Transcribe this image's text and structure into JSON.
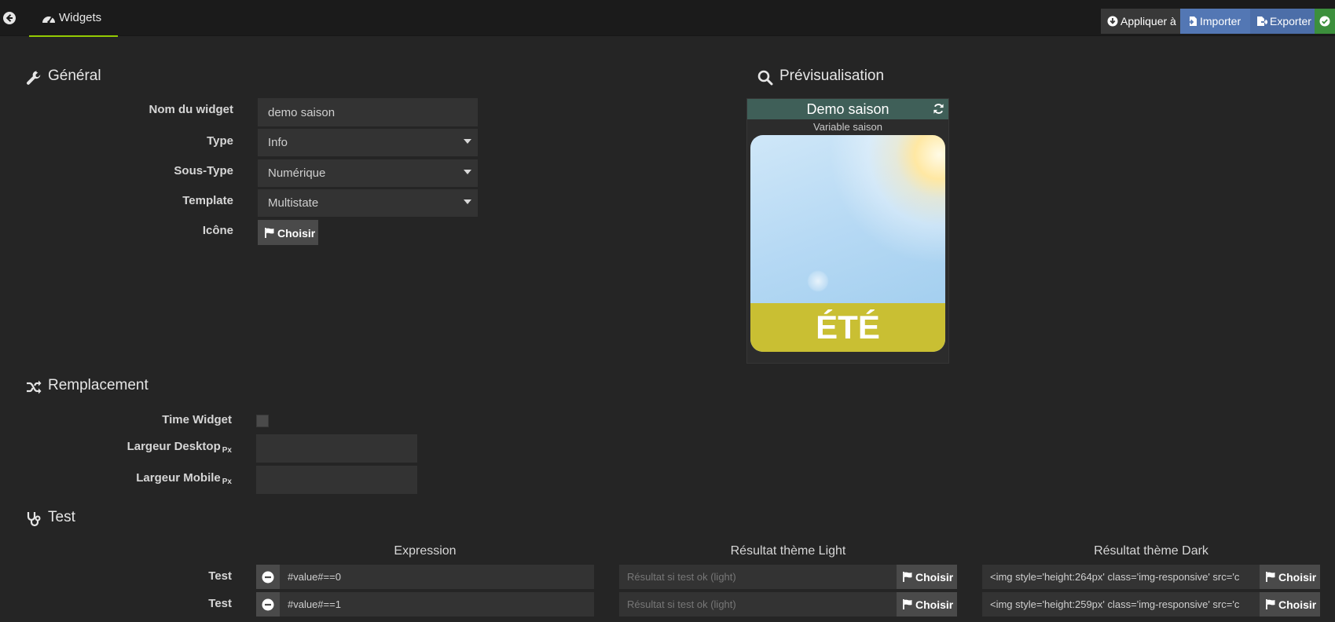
{
  "topbar": {
    "tab_label": "Widgets",
    "apply_label": "Appliquer à",
    "import_label": "Importer",
    "export_label": "Exporter",
    "accent_color": "#94ca02"
  },
  "general": {
    "title": "Général",
    "name_label": "Nom du widget",
    "name_value": "demo saison",
    "type_label": "Type",
    "type_value": "Info",
    "subtype_label": "Sous-Type",
    "subtype_value": "Numérique",
    "template_label": "Template",
    "template_value": "Multistate",
    "icon_label": "Icône",
    "icon_button": "Choisir"
  },
  "preview": {
    "title": "Prévisualisation",
    "widget_name": "Demo saison",
    "variable": "Variable saison",
    "state": "ÉTÉ",
    "header_color": "#3f5f58",
    "band_color": "#c9bf33"
  },
  "replacement": {
    "title": "Remplacement",
    "time_widget_label": "Time Widget",
    "time_widget_checked": false,
    "desktop_label": "Largeur Desktop",
    "mobile_label": "Largeur Mobile",
    "unit": "Px",
    "desktop_value": "",
    "mobile_value": ""
  },
  "test": {
    "title": "Test",
    "col_expression": "Expression",
    "col_light": "Résultat thème Light",
    "col_dark": "Résultat thème Dark",
    "rows": [
      {
        "label": "Test",
        "expression": "#value#==0",
        "light_placeholder": "Résultat si test ok (light)",
        "dark_value": "<img style='height:264px'  class='img-responsive' src='c",
        "choose": "Choisir"
      },
      {
        "label": "Test",
        "expression": "#value#==1",
        "light_placeholder": "Résultat si test ok (light)",
        "dark_value": "<img style='height:259px'  class='img-responsive' src='c",
        "choose": "Choisir"
      }
    ]
  }
}
